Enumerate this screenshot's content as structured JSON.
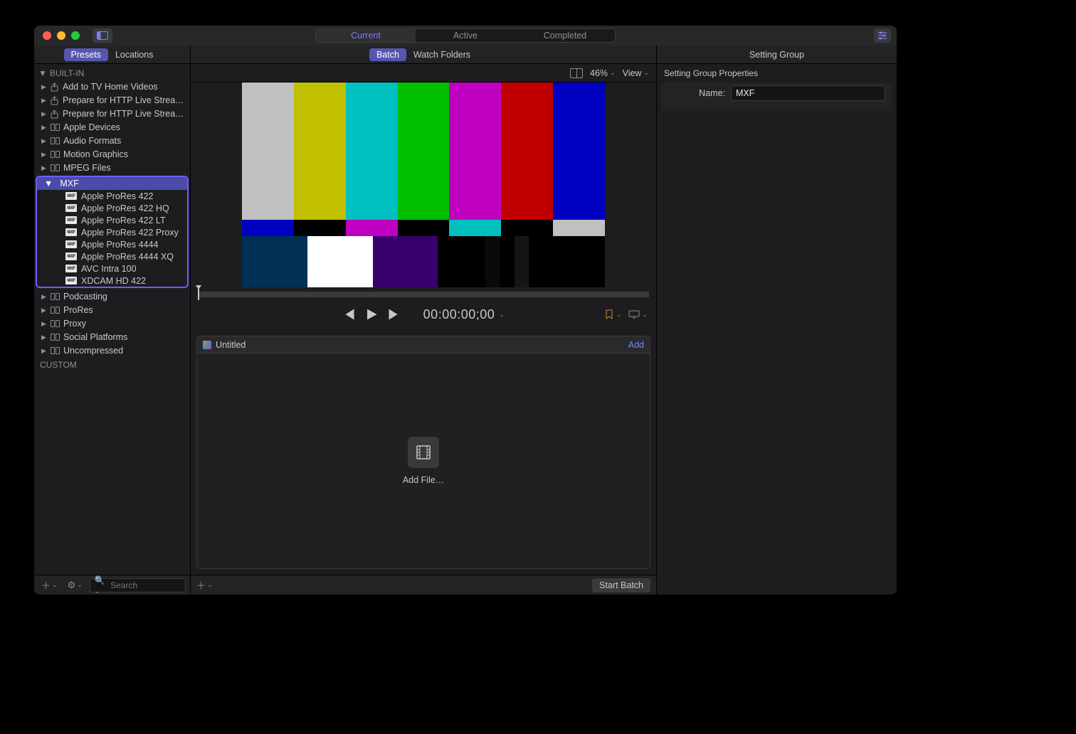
{
  "titlebar": {
    "segments": {
      "current": "Current",
      "active": "Active",
      "completed": "Completed"
    }
  },
  "sidebar": {
    "tabs": {
      "presets": "Presets",
      "locations": "Locations"
    },
    "builtin_label": "BUILT-IN",
    "items_top": [
      "Add to TV Home Videos",
      "Prepare for HTTP Live Strea…",
      "Prepare for HTTP Live Strea…"
    ],
    "groups_above": [
      "Apple Devices",
      "Audio Formats",
      "Motion Graphics",
      "MPEG Files"
    ],
    "mxf": {
      "label": "MXF",
      "children": [
        "Apple ProRes 422",
        "Apple ProRes 422 HQ",
        "Apple ProRes 422 LT",
        "Apple ProRes 422 Proxy",
        "Apple ProRes 4444",
        "Apple ProRes 4444 XQ",
        "AVC Intra 100",
        "XDCAM HD 422"
      ],
      "badge": "MXF"
    },
    "groups_below": [
      "Podcasting",
      "ProRes",
      "Proxy",
      "Social Platforms",
      "Uncompressed"
    ],
    "custom_label": "CUSTOM",
    "search_placeholder": "Search"
  },
  "center": {
    "tabs": {
      "batch": "Batch",
      "watch": "Watch Folders"
    },
    "zoom": "46%",
    "view": "View",
    "timecode": "00:00:00;00",
    "batch_title": "Untitled",
    "add_link": "Add",
    "addfile_label": "Add File…",
    "start_label": "Start Batch"
  },
  "inspector": {
    "title": "Setting Group",
    "sub": "Setting Group Properties",
    "name_label": "Name:",
    "name_value": "MXF"
  },
  "smpte": {
    "top": [
      "#c0c0c0",
      "#c0c000",
      "#00c0c0",
      "#00c000",
      "#c000c0",
      "#c00000",
      "#0000c0"
    ],
    "mid": [
      "#0000c0",
      "#000000",
      "#c000c0",
      "#000000",
      "#00c0c0",
      "#000000",
      "#c0c0c0"
    ],
    "bot": [
      {
        "c": "#003055",
        "w": 18
      },
      {
        "c": "#ffffff",
        "w": 18
      },
      {
        "c": "#3a006d",
        "w": 18
      },
      {
        "c": "#000000",
        "w": 13
      },
      {
        "c": "#0a0a0a",
        "w": 4
      },
      {
        "c": "#000000",
        "w": 4
      },
      {
        "c": "#151515",
        "w": 4
      },
      {
        "c": "#000000",
        "w": 21
      }
    ]
  }
}
